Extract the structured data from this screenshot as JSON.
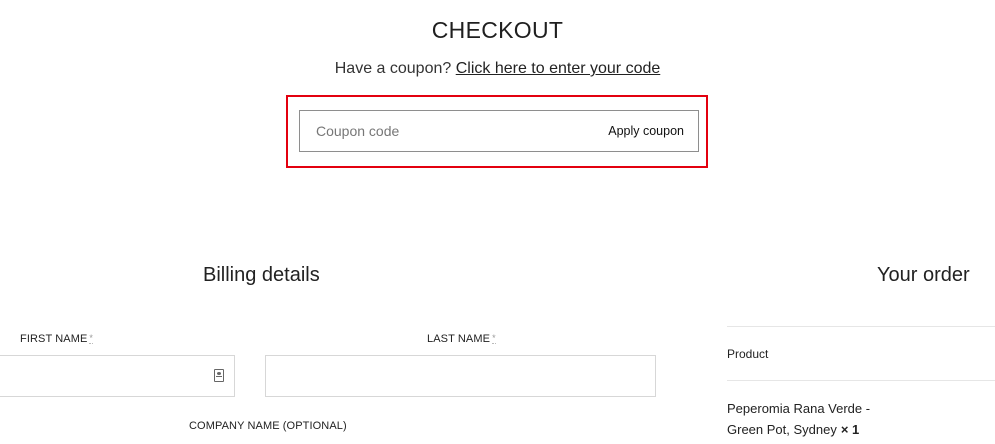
{
  "page": {
    "title": "CHECKOUT",
    "coupon_prompt_text": "Have a coupon?",
    "coupon_prompt_link": "Click here to enter your code"
  },
  "coupon": {
    "placeholder": "Coupon code",
    "apply_label": "Apply coupon"
  },
  "billing": {
    "title": "Billing details",
    "first_name_label": "FIRST NAME",
    "last_name_label": "LAST NAME",
    "company_label": "COMPANY NAME (OPTIONAL)",
    "required_marker": "*"
  },
  "order": {
    "title": "Your order",
    "product_header": "Product",
    "item_name": "Peperomia Rana Verde - Green Pot, Sydney",
    "item_qty": "× 1"
  },
  "colors": {
    "highlight": "#e3000f"
  }
}
